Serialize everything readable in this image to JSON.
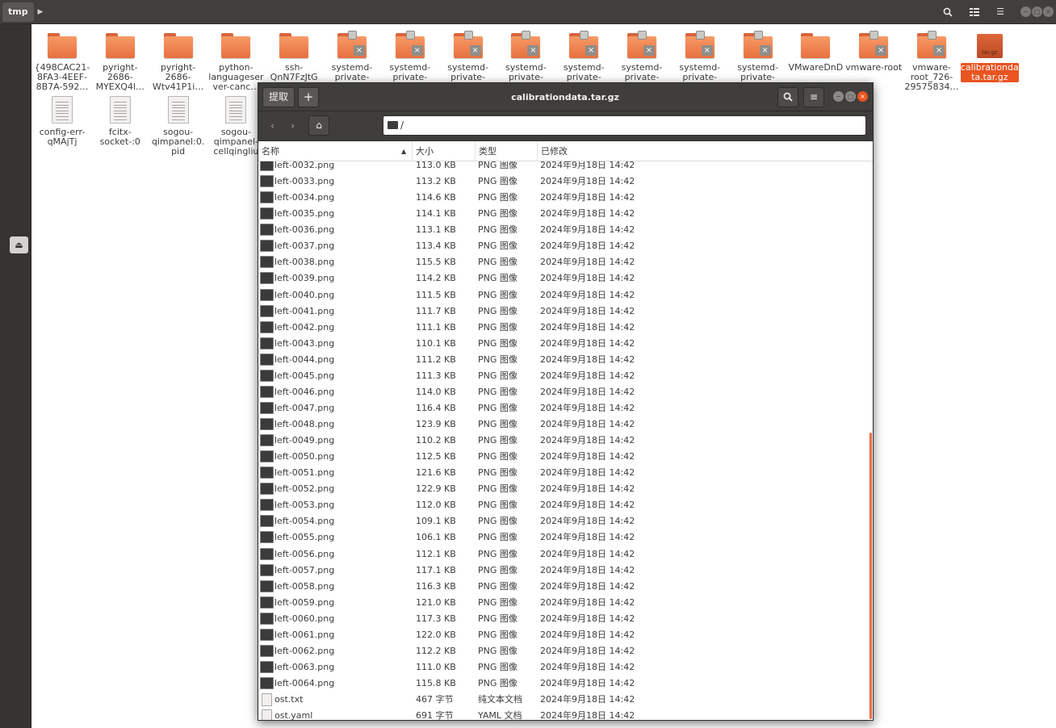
{
  "nautilus": {
    "path_label": "tmp",
    "icons": [
      {
        "label": "{498CAC21-8FA3-4EEF-8B7A-592…",
        "type": "folder"
      },
      {
        "label": "pyright-2686-MYEXQ4l…",
        "type": "folder"
      },
      {
        "label": "pyright-2686-Wtv41P1i…",
        "type": "folder"
      },
      {
        "label": "python-languageserver-canc…",
        "type": "folder"
      },
      {
        "label": "ssh-QnN7FzJtG",
        "type": "folder"
      },
      {
        "label": "systemd-private-",
        "type": "locked-folder"
      },
      {
        "label": "systemd-private-",
        "type": "locked-folder"
      },
      {
        "label": "systemd-private-",
        "type": "locked-folder"
      },
      {
        "label": "systemd-private-",
        "type": "locked-folder"
      },
      {
        "label": "systemd-private-",
        "type": "locked-folder"
      },
      {
        "label": "systemd-private-",
        "type": "locked-folder"
      },
      {
        "label": "systemd-private-",
        "type": "locked-folder"
      },
      {
        "label": "systemd-private-",
        "type": "locked-folder"
      },
      {
        "label": "VMwareDnD",
        "type": "folder"
      },
      {
        "label": "vmware-root",
        "type": "locked-folder"
      },
      {
        "label": "vmware-root_726-29575834…",
        "type": "locked-folder"
      },
      {
        "label": "calibrationdata.tar.gz",
        "type": "archive",
        "badge": "tar.gz"
      },
      {
        "label": "config-err-qMAjTj",
        "type": "document"
      },
      {
        "label": "fcitx-socket-:0",
        "type": "document"
      },
      {
        "label": "sogou-qimpanel:0.pid",
        "type": "document"
      },
      {
        "label": "sogou-qimpanel-cellqingliu",
        "type": "document"
      }
    ]
  },
  "archive": {
    "title": "calibrationdata.tar.gz",
    "extract_label": "提取",
    "add_label": "+",
    "location": "/",
    "columns": {
      "name": "名称",
      "size": "大小",
      "type": "类型",
      "modified": "已修改"
    },
    "files": [
      {
        "name": "left-0032.png",
        "size": "113.0 KB",
        "type": "PNG 图像",
        "modified": "2024年9月18日 14:42",
        "kind": "png"
      },
      {
        "name": "left-0033.png",
        "size": "113.2 KB",
        "type": "PNG 图像",
        "modified": "2024年9月18日 14:42",
        "kind": "png"
      },
      {
        "name": "left-0034.png",
        "size": "114.6 KB",
        "type": "PNG 图像",
        "modified": "2024年9月18日 14:42",
        "kind": "png"
      },
      {
        "name": "left-0035.png",
        "size": "114.1 KB",
        "type": "PNG 图像",
        "modified": "2024年9月18日 14:42",
        "kind": "png"
      },
      {
        "name": "left-0036.png",
        "size": "113.1 KB",
        "type": "PNG 图像",
        "modified": "2024年9月18日 14:42",
        "kind": "png"
      },
      {
        "name": "left-0037.png",
        "size": "113.4 KB",
        "type": "PNG 图像",
        "modified": "2024年9月18日 14:42",
        "kind": "png"
      },
      {
        "name": "left-0038.png",
        "size": "115.5 KB",
        "type": "PNG 图像",
        "modified": "2024年9月18日 14:42",
        "kind": "png"
      },
      {
        "name": "left-0039.png",
        "size": "114.2 KB",
        "type": "PNG 图像",
        "modified": "2024年9月18日 14:42",
        "kind": "png"
      },
      {
        "name": "left-0040.png",
        "size": "111.5 KB",
        "type": "PNG 图像",
        "modified": "2024年9月18日 14:42",
        "kind": "png"
      },
      {
        "name": "left-0041.png",
        "size": "111.7 KB",
        "type": "PNG 图像",
        "modified": "2024年9月18日 14:42",
        "kind": "png"
      },
      {
        "name": "left-0042.png",
        "size": "111.1 KB",
        "type": "PNG 图像",
        "modified": "2024年9月18日 14:42",
        "kind": "png"
      },
      {
        "name": "left-0043.png",
        "size": "110.1 KB",
        "type": "PNG 图像",
        "modified": "2024年9月18日 14:42",
        "kind": "png"
      },
      {
        "name": "left-0044.png",
        "size": "111.2 KB",
        "type": "PNG 图像",
        "modified": "2024年9月18日 14:42",
        "kind": "png"
      },
      {
        "name": "left-0045.png",
        "size": "111.3 KB",
        "type": "PNG 图像",
        "modified": "2024年9月18日 14:42",
        "kind": "png"
      },
      {
        "name": "left-0046.png",
        "size": "114.0 KB",
        "type": "PNG 图像",
        "modified": "2024年9月18日 14:42",
        "kind": "png"
      },
      {
        "name": "left-0047.png",
        "size": "116.4 KB",
        "type": "PNG 图像",
        "modified": "2024年9月18日 14:42",
        "kind": "png"
      },
      {
        "name": "left-0048.png",
        "size": "123.9 KB",
        "type": "PNG 图像",
        "modified": "2024年9月18日 14:42",
        "kind": "png"
      },
      {
        "name": "left-0049.png",
        "size": "110.2 KB",
        "type": "PNG 图像",
        "modified": "2024年9月18日 14:42",
        "kind": "png"
      },
      {
        "name": "left-0050.png",
        "size": "112.5 KB",
        "type": "PNG 图像",
        "modified": "2024年9月18日 14:42",
        "kind": "png"
      },
      {
        "name": "left-0051.png",
        "size": "121.6 KB",
        "type": "PNG 图像",
        "modified": "2024年9月18日 14:42",
        "kind": "png"
      },
      {
        "name": "left-0052.png",
        "size": "122.9 KB",
        "type": "PNG 图像",
        "modified": "2024年9月18日 14:42",
        "kind": "png"
      },
      {
        "name": "left-0053.png",
        "size": "112.0 KB",
        "type": "PNG 图像",
        "modified": "2024年9月18日 14:42",
        "kind": "png"
      },
      {
        "name": "left-0054.png",
        "size": "109.1 KB",
        "type": "PNG 图像",
        "modified": "2024年9月18日 14:42",
        "kind": "png"
      },
      {
        "name": "left-0055.png",
        "size": "106.1 KB",
        "type": "PNG 图像",
        "modified": "2024年9月18日 14:42",
        "kind": "png"
      },
      {
        "name": "left-0056.png",
        "size": "112.1 KB",
        "type": "PNG 图像",
        "modified": "2024年9月18日 14:42",
        "kind": "png"
      },
      {
        "name": "left-0057.png",
        "size": "117.1 KB",
        "type": "PNG 图像",
        "modified": "2024年9月18日 14:42",
        "kind": "png"
      },
      {
        "name": "left-0058.png",
        "size": "116.3 KB",
        "type": "PNG 图像",
        "modified": "2024年9月18日 14:42",
        "kind": "png"
      },
      {
        "name": "left-0059.png",
        "size": "121.0 KB",
        "type": "PNG 图像",
        "modified": "2024年9月18日 14:42",
        "kind": "png"
      },
      {
        "name": "left-0060.png",
        "size": "117.3 KB",
        "type": "PNG 图像",
        "modified": "2024年9月18日 14:42",
        "kind": "png"
      },
      {
        "name": "left-0061.png",
        "size": "122.0 KB",
        "type": "PNG 图像",
        "modified": "2024年9月18日 14:42",
        "kind": "png"
      },
      {
        "name": "left-0062.png",
        "size": "112.2 KB",
        "type": "PNG 图像",
        "modified": "2024年9月18日 14:42",
        "kind": "png"
      },
      {
        "name": "left-0063.png",
        "size": "111.0 KB",
        "type": "PNG 图像",
        "modified": "2024年9月18日 14:42",
        "kind": "png"
      },
      {
        "name": "left-0064.png",
        "size": "115.8 KB",
        "type": "PNG 图像",
        "modified": "2024年9月18日 14:42",
        "kind": "png"
      },
      {
        "name": "ost.txt",
        "size": "467 字节",
        "type": "纯文本文档",
        "modified": "2024年9月18日 14:42",
        "kind": "text"
      },
      {
        "name": "ost.yaml",
        "size": "691 字节",
        "type": "YAML 文档",
        "modified": "2024年9月18日 14:42",
        "kind": "text"
      }
    ]
  }
}
